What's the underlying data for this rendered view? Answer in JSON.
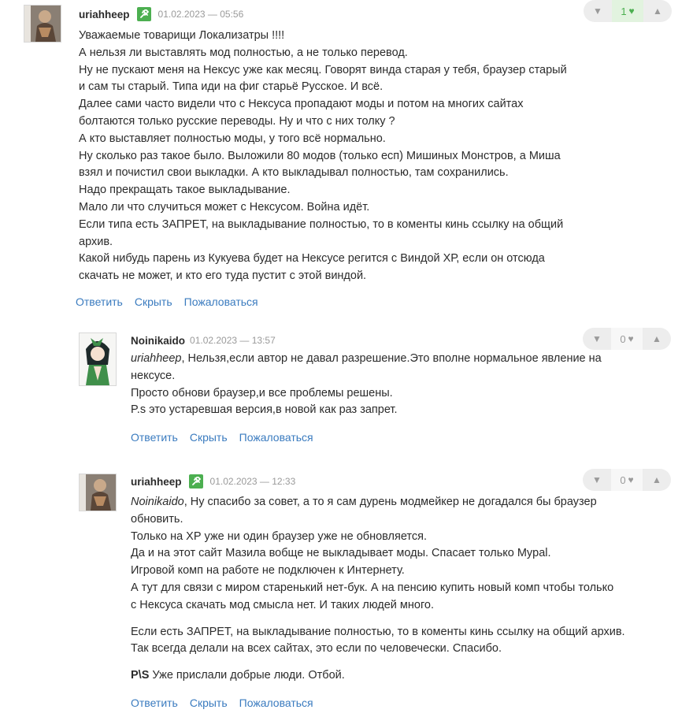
{
  "colors": {
    "link": "#3a7bbf",
    "badge": "#4caf50",
    "muted": "#9a9a9a"
  },
  "actions": {
    "reply": "Ответить",
    "hide": "Скрыть",
    "report": "Пожаловаться"
  },
  "comments": [
    {
      "author": "uriahheep",
      "date": "01.02.2023 — 05:56",
      "votes": "1",
      "lines": [
        "Уважаемые товарищи Локализатры !!!!",
        "А нельзя ли выставлять мод полностью, а не только перевод.",
        "Ну не пускают меня на Нексус уже как месяц. Говорят винда старая у тебя, браузер старый",
        "и сам ты старый. Типа иди на фиг старьё Русское. И всё.",
        "Далее сами часто видели что с Нексуса пропадают моды и потом на многих сайтах",
        "болтаются только русские переводы. Ну и что с них толку ?",
        "А кто выставляет полностью моды, у того всё нормально.",
        "Ну сколько раз такое было. Выложили 80 модов (только есп) Мишиных Монстров, а Миша",
        "взял и почистил свои выкладки. А кто выкладывал полностью, там сохранились.",
        "Надо прекращать такое выкладывание.",
        "Мало ли что случиться может с Нексусом. Война идёт.",
        "Если типа есть ЗАПРЕТ, на выкладывание полностью, то в коменты кинь ссылку на общий",
        "архив.",
        "Какой нибудь парень из Кукуева будет на Нексусе регится с Виндой ХР, если он отсюда",
        "скачать не может, и кто его туда пустит с этой виндой."
      ]
    },
    {
      "author": "Noinikaido",
      "date": "01.02.2023 — 13:57",
      "votes": "0",
      "mention": "uriahheep",
      "line1_rest": ", Нельзя,если автор не давал разрешение.Это вполне нормальное явление на",
      "lines": [
        "нексусе.",
        "Просто обнови браузер,и все проблемы решены.",
        "P.s это устаревшая версия,в новой как раз запрет."
      ]
    },
    {
      "author": "uriahheep",
      "date": "01.02.2023 — 12:33",
      "votes": "0",
      "mention": "Noinikaido",
      "line1_rest": ", Ну спасибо за совет, а то я сам дурень модмейкер не догадался бы браузер",
      "lines": [
        "обновить.",
        "Только на ХР уже ни один браузер уже не обновляется.",
        "Да и на этот сайт Мазила вобще не выкладывает моды. Спасает только Mypal.",
        "Игровой комп на работе не подключен к Интернету.",
        "А тут для связи с миром старенький нет-бук. А на пенсию купить новый комп чтобы только",
        "с Нексуса скачать мод смысла нет. И таких людей много."
      ],
      "para2": [
        "Если есть ЗАПРЕТ, на выкладывание полностью, то в коменты кинь ссылку на общий архив.",
        "Так всегда делали на всех сайтах, это если по человечески. Спасибо."
      ],
      "ps_bold": "P\\S",
      "ps_rest": " Уже прислали добрые люди. Отбой."
    }
  ]
}
